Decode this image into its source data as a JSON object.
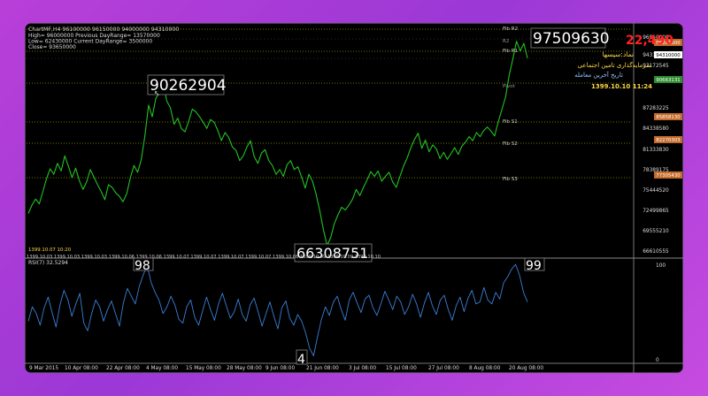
{
  "window": {
    "title": "ChartMF,H4  96100000 96150000 94000000 94310000",
    "info_lines": [
      "High= 96000000 Previous DayRange= 13570000",
      "Low= 62430000 Current DayRange= 3500000",
      "Close= 93650000"
    ]
  },
  "overlay": {
    "top_right_value": "97509630",
    "change_value": "22,490",
    "symbol": "نماد:سیسها",
    "company": "سرمایه‌گذاری تامین اجتماعی",
    "last_trade_label": "تاریخ آخرین معامله",
    "last_trade_time": "1399.10.10  11:24",
    "peak_label": "90262904",
    "low_label": "66308751",
    "rsi_high_label": "98",
    "rsi_peak2_label": "99",
    "rsi_low_label": "4",
    "last_date": "1399.10.07 10:20",
    "rsi_title": "RSI(7) 32.5294"
  },
  "pivot_labels": [
    "Fib R2",
    "R2",
    "Fib R1",
    "Pivot",
    "Fib S1",
    "Fib S2",
    "Fib S3"
  ],
  "price_axis_labels": [
    "96950000",
    "94310000",
    "93172545",
    "87283225",
    "84338580",
    "81333830",
    "78389175",
    "75444520",
    "72499865",
    "69555210",
    "66610555"
  ],
  "price_axis_tags": [
    {
      "text": "96063000",
      "color": "#c46a2a"
    },
    {
      "text": "94310000",
      "color": "#ffffff"
    },
    {
      "text": "90663131",
      "color": "#2e8b2e"
    },
    {
      "text": "85858130",
      "color": "#c46a2a"
    },
    {
      "text": "82270303",
      "color": "#c46a2a"
    },
    {
      "text": "77305430",
      "color": "#c46a2a"
    }
  ],
  "date_strip": "1399.10.03  1399.10.03  1399.10.03  1399.10.06  1399.10.06  1399.10.07  1399.10.07  1399.10.07  1399.10.07  1399.10.08  1399.10.09  1399.10.09  1399.10.10",
  "rsi_axis_labels": [
    "100",
    "0"
  ],
  "time_axis_labels": [
    "9 Mar 2015",
    "10 Apr 08:00",
    "22 Apr 08:00",
    "4 May 08:00",
    "15 May 08:00",
    "28 May 08:00",
    "9 Jun 08:00",
    "21 Jun 08:00",
    "3 Jul 08:00",
    "15 Jul 08:00",
    "27 Jul 08:00",
    "8 Aug 08:00",
    "20 Aug 08:00"
  ],
  "colors": {
    "price_line": "#22c322",
    "rsi_line": "#3a7fd5",
    "pivot_line": "#9a9a00",
    "grid_dots": "#555555",
    "change_value": "#ff2020",
    "symbol": "#ffd84a",
    "last_trade_label": "#8fc6ff",
    "last_trade_time": "#ffd84a"
  },
  "chart_data": [
    {
      "type": "line",
      "series": [
        {
          "values": [
            71000000,
            72200000,
            73100000,
            72400000,
            74200000,
            76100000,
            77500000,
            76700000,
            78300000,
            77200000,
            79400000,
            77900000,
            76200000,
            77600000,
            75800000,
            74500000,
            75600000,
            77400000,
            76300000,
            75200000,
            74200000,
            73000000,
            75200000,
            74800000,
            74000000,
            73500000,
            72700000,
            73900000,
            76200000,
            78000000,
            77000000,
            78800000,
            82300000,
            86800000,
            85100000,
            87800000,
            88600000,
            90262904,
            87400000,
            86400000,
            84000000,
            84900000,
            83400000,
            82900000,
            84400000,
            86200000,
            85800000,
            85100000,
            84300000,
            83400000,
            84700000,
            84300000,
            83100000,
            81600000,
            82800000,
            82100000,
            80700000,
            80200000,
            78700000,
            79400000,
            80700000,
            81600000,
            79300000,
            78300000,
            79800000,
            80300000,
            78700000,
            78000000,
            76700000,
            77400000,
            76400000,
            78100000,
            78700000,
            77400000,
            77800000,
            76300000,
            74700000,
            76700000,
            75700000,
            73800000,
            71400000,
            68600000,
            66308751,
            67500000,
            69500000,
            70800000,
            71900000,
            71500000,
            72200000,
            73100000,
            74500000,
            73600000,
            74800000,
            75900000,
            77100000,
            76400000,
            77200000,
            75700000,
            76400000,
            77000000,
            75600000,
            74800000,
            76400000,
            77900000,
            79100000,
            80600000,
            81800000,
            82700000,
            80500000,
            81700000,
            80000000,
            81000000,
            80400000,
            79000000,
            79900000,
            78900000,
            79700000,
            80600000,
            79600000,
            80800000,
            81400000,
            82200000,
            81600000,
            82800000,
            82200000,
            83100000,
            83600000,
            83000000,
            82300000,
            84400000,
            86200000,
            88000000,
            91200000,
            93500000,
            96100000,
            94700000,
            95800000,
            93650000
          ]
        }
      ],
      "ylim": [
        65000000,
        98000000
      ]
    },
    {
      "type": "line",
      "title": "RSI(7) 32.5294",
      "series": [
        {
          "values": [
            40,
            55,
            48,
            36,
            54,
            65,
            49,
            34,
            57,
            72,
            62,
            45,
            58,
            69,
            38,
            30,
            48,
            62,
            55,
            40,
            52,
            61,
            48,
            35,
            59,
            74,
            66,
            58,
            76,
            88,
            98,
            80,
            70,
            62,
            48,
            55,
            66,
            57,
            42,
            38,
            55,
            62,
            44,
            36,
            51,
            65,
            52,
            41,
            58,
            69,
            56,
            43,
            50,
            63,
            47,
            40,
            57,
            64,
            50,
            35,
            48,
            60,
            45,
            32,
            54,
            61,
            43,
            36,
            47,
            40,
            28,
            12,
            4,
            24,
            42,
            55,
            46,
            60,
            66,
            52,
            41,
            62,
            70,
            59,
            49,
            63,
            67,
            54,
            46,
            58,
            71,
            62,
            52,
            66,
            60,
            47,
            55,
            68,
            58,
            44,
            59,
            70,
            56,
            47,
            62,
            67,
            52,
            41,
            56,
            65,
            50,
            64,
            72,
            58,
            60,
            75,
            62,
            58,
            70,
            63,
            80,
            86,
            94,
            99,
            88,
            70,
            60
          ]
        }
      ],
      "ylim": [
        0,
        100
      ]
    }
  ]
}
